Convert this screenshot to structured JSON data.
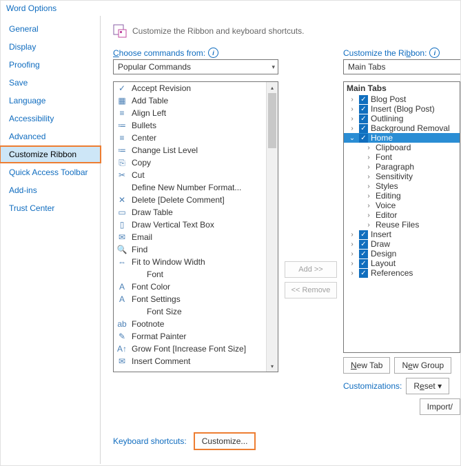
{
  "window_title": "Word Options",
  "sidebar": {
    "items": [
      {
        "label": "General"
      },
      {
        "label": "Display"
      },
      {
        "label": "Proofing"
      },
      {
        "label": "Save"
      },
      {
        "label": "Language"
      },
      {
        "label": "Accessibility"
      },
      {
        "label": "Advanced"
      },
      {
        "label": "Customize Ribbon",
        "selected": true
      },
      {
        "label": "Quick Access Toolbar"
      },
      {
        "label": "Add-ins"
      },
      {
        "label": "Trust Center"
      }
    ]
  },
  "heading_text": "Customize the Ribbon and keyboard shortcuts.",
  "left": {
    "choose_label": "Choose commands from:",
    "choose_value": "Popular Commands",
    "commands": [
      {
        "icon": "✓",
        "label": "Accept Revision"
      },
      {
        "icon": "▦",
        "label": "Add Table",
        "sub": true
      },
      {
        "icon": "≡",
        "label": "Align Left"
      },
      {
        "icon": "≔",
        "label": "Bullets",
        "sub": true
      },
      {
        "icon": "≡",
        "label": "Center"
      },
      {
        "icon": "≔",
        "label": "Change List Level",
        "sub": true
      },
      {
        "icon": "⎘",
        "label": "Copy"
      },
      {
        "icon": "✂",
        "label": "Cut"
      },
      {
        "icon": "",
        "label": "Define New Number Format..."
      },
      {
        "icon": "✕",
        "label": "Delete [Delete Comment]"
      },
      {
        "icon": "▭",
        "label": "Draw Table"
      },
      {
        "icon": "▯",
        "label": "Draw Vertical Text Box"
      },
      {
        "icon": "✉",
        "label": "Email"
      },
      {
        "icon": "🔍",
        "label": "Find"
      },
      {
        "icon": "⇔",
        "label": "Fit to Window Width"
      },
      {
        "icon": "",
        "label": "Font",
        "indent": true,
        "picker": true
      },
      {
        "icon": "A",
        "label": "Font Color",
        "sub": true
      },
      {
        "icon": "A",
        "label": "Font Settings"
      },
      {
        "icon": "",
        "label": "Font Size",
        "indent": true,
        "picker": true
      },
      {
        "icon": "ab",
        "label": "Footnote"
      },
      {
        "icon": "✎",
        "label": "Format Painter"
      },
      {
        "icon": "A↑",
        "label": "Grow Font [Increase Font Size]"
      },
      {
        "icon": "✉",
        "label": "Insert Comment"
      }
    ]
  },
  "mid": {
    "add_label": "Add >>",
    "remove_label": "<< Remove"
  },
  "right": {
    "ribbon_label": "Customize the Ribbon:",
    "ribbon_value": "Main Tabs",
    "tree_header": "Main Tabs",
    "top_nodes": [
      {
        "label": "Blog Post"
      },
      {
        "label": "Insert (Blog Post)"
      },
      {
        "label": "Outlining"
      },
      {
        "label": "Background Removal"
      }
    ],
    "home": {
      "label": "Home",
      "children": [
        "Clipboard",
        "Font",
        "Paragraph",
        "Sensitivity",
        "Styles",
        "Editing",
        "Voice",
        "Editor",
        "Reuse Files"
      ]
    },
    "bottom_nodes": [
      {
        "label": "Insert"
      },
      {
        "label": "Draw"
      },
      {
        "label": "Design"
      },
      {
        "label": "Layout"
      },
      {
        "label": "References"
      }
    ],
    "new_tab": "New Tab",
    "new_group": "New Group",
    "customizations_label": "Customizations:",
    "reset": "Reset",
    "import": "Import/"
  },
  "keyboard": {
    "label": "Keyboard shortcuts:",
    "button": "Customize..."
  },
  "icons": {
    "heading": "customize-ribbon-icon"
  }
}
